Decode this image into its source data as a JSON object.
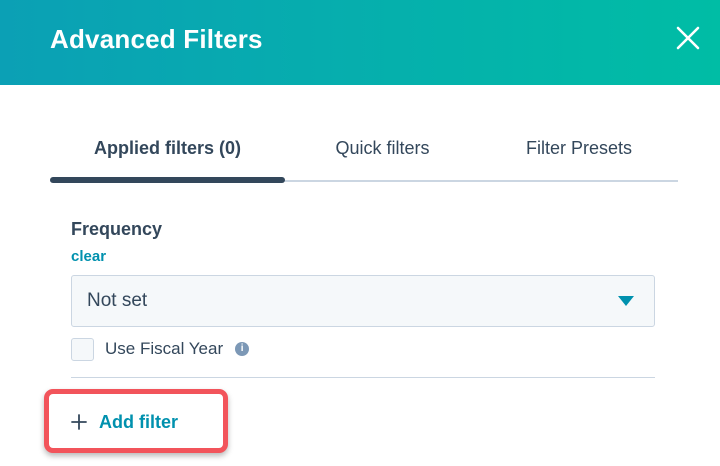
{
  "header": {
    "title": "Advanced Filters",
    "close_icon": "close-icon"
  },
  "tabs": [
    {
      "label": "Applied filters (0)",
      "active": true
    },
    {
      "label": "Quick filters",
      "active": false
    },
    {
      "label": "Filter Presets",
      "active": false
    }
  ],
  "filter": {
    "label": "Frequency",
    "clear_label": "clear",
    "select_value": "Not set",
    "caret_icon": "caret-down-icon"
  },
  "fiscal_year": {
    "label": "Use Fiscal Year",
    "checked": false,
    "info_icon": "info-icon"
  },
  "actions": {
    "add_filter_label": "Add filter",
    "add_icon": "plus-icon"
  },
  "colors": {
    "header_gradient_start": "#0ba0b5",
    "header_gradient_end": "#00bda5",
    "link": "#0091ae",
    "text": "#33475b",
    "highlight_border": "#f2545b"
  }
}
